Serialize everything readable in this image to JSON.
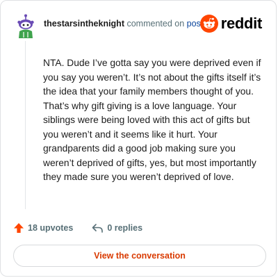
{
  "header": {
    "username": "thestarsintheknight",
    "commented_text": "commented on",
    "post_link": "post",
    "brand": "reddit"
  },
  "colors": {
    "brand_orange": "#ff4500",
    "link_blue": "#0a449b",
    "button_text": "#d93a00",
    "meta_gray": "#576f76"
  },
  "icons": {
    "avatar": "snoo-avatar-icon",
    "brand": "reddit-logo-icon",
    "upvote": "upvote-arrow-icon",
    "reply": "reply-arrow-icon"
  },
  "comment": {
    "text": "NTA. Dude I’ve gotta say you were deprived even if you say you weren’t. It’s not about the gifts itself it’s the idea that your family members thought of you. That’s why gift giving is a love language. Your siblings were being loved with this act of gifts but you weren’t and it seems like it hurt. Your grandparents did a good job making sure you weren’t deprived of gifts, yes, but most importantly they made sure you weren’t deprived of love."
  },
  "actions": {
    "upvotes": "18 upvotes",
    "replies": "0 replies"
  },
  "button": {
    "label": "View the conversation"
  }
}
